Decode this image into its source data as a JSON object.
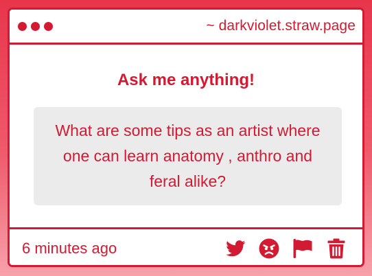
{
  "window": {
    "url": "~ darkviolet.straw.page"
  },
  "main": {
    "heading": "Ask me anything!",
    "question": "What are some tips as an artist where one can learn anatomy , anthro and feral alike?"
  },
  "footer": {
    "timestamp": "6 minutes ago",
    "actions": [
      {
        "icon": "twitter-icon"
      },
      {
        "icon": "angry-face-icon"
      },
      {
        "icon": "flag-icon"
      },
      {
        "icon": "trash-icon"
      }
    ]
  },
  "colors": {
    "accent": "#d21a32",
    "question_bg": "#ecebeb",
    "page_bg_top": "#e8354c",
    "page_bg_bottom": "#f7a1aa"
  }
}
